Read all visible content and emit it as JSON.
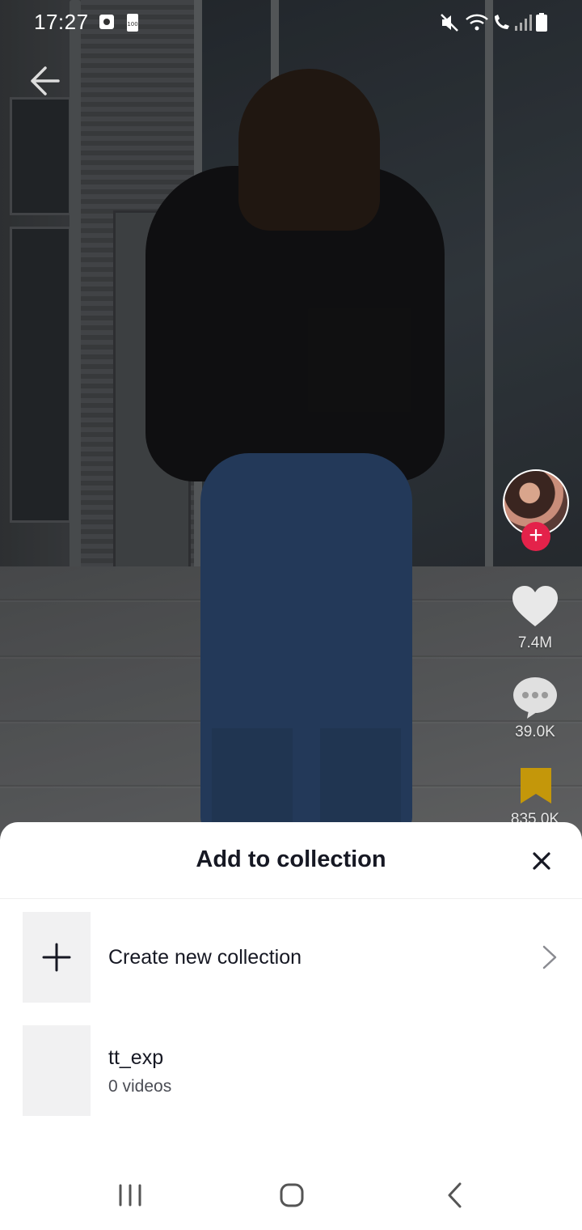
{
  "status_bar": {
    "time": "17:27",
    "battery_badge": "100",
    "left_icons": [
      "screen-record-icon",
      "battery-saver-icon"
    ],
    "right_icons": [
      "mute-icon",
      "wifi-icon",
      "wifi-call-icon",
      "signal-icon",
      "battery-icon"
    ]
  },
  "video": {
    "like_count": "7.4M",
    "comment_count": "39.0K",
    "save_count": "835.0K",
    "colors": {
      "follow": "#e4224a",
      "saved": "#d4a20a"
    }
  },
  "sheet": {
    "title": "Add to collection",
    "create_label": "Create new collection",
    "collections": [
      {
        "name": "tt_exp",
        "count": "0 videos"
      }
    ]
  },
  "navbar": {
    "buttons": [
      "recent-apps-icon",
      "home-icon",
      "back-icon"
    ]
  }
}
